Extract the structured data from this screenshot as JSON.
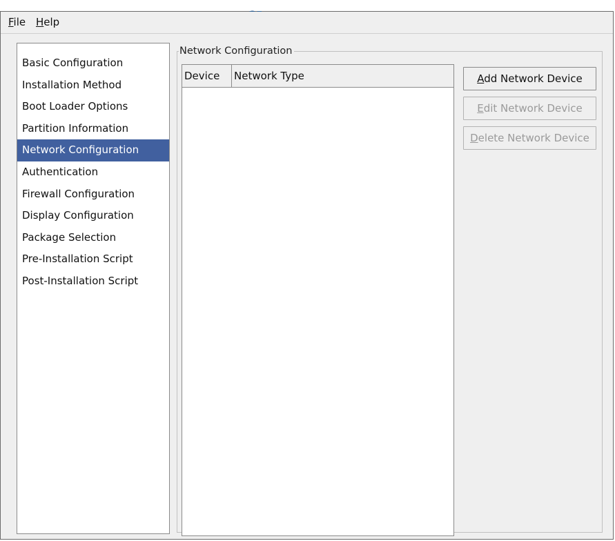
{
  "menu": [
    {
      "mnemonic": "F",
      "rest": "ile"
    },
    {
      "mnemonic": "H",
      "rest": "elp"
    }
  ],
  "sidebar": {
    "items": [
      {
        "label": "Basic Configuration"
      },
      {
        "label": "Installation Method"
      },
      {
        "label": "Boot Loader Options"
      },
      {
        "label": "Partition Information"
      },
      {
        "label": "Network Configuration",
        "selected": true
      },
      {
        "label": "Authentication"
      },
      {
        "label": "Firewall Configuration"
      },
      {
        "label": "Display Configuration"
      },
      {
        "label": "Package Selection"
      },
      {
        "label": "Pre-Installation Script"
      },
      {
        "label": "Post-Installation Script"
      }
    ]
  },
  "network": {
    "group_title": "Network Configuration",
    "columns": [
      "Device",
      "Network Type"
    ],
    "rows": []
  },
  "buttons": {
    "add": {
      "mnemonic": "A",
      "rest": "dd Network Device",
      "enabled": true
    },
    "edit": {
      "mnemonic": "E",
      "rest": "dit Network Device",
      "enabled": false
    },
    "delete": {
      "mnemonic": "D",
      "rest": "elete Network Device",
      "enabled": false
    }
  },
  "colors": {
    "selection": "#41609f",
    "window_bg": "#efefef",
    "title_fragment": "#2e5d8f"
  }
}
